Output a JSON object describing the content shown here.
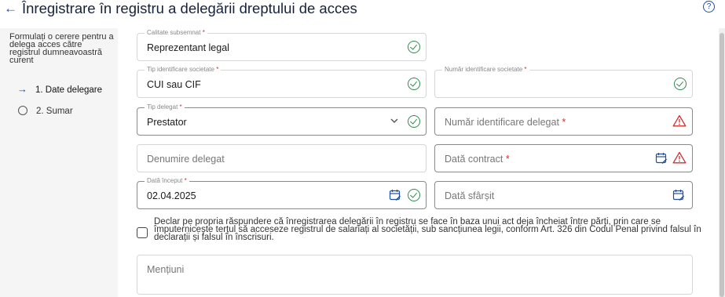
{
  "header": {
    "title": "Înregistrare în registru a delegării dreptului de acces",
    "back_icon": "arrow-left-icon",
    "help_glyph": "?"
  },
  "sidebar": {
    "description": "Formulați o cerere pentru a delega acces către registrul dumneavoastră curent",
    "steps": [
      {
        "label": "1. Date delegare",
        "state": "current"
      },
      {
        "label": "2. Sumar",
        "state": "pending"
      }
    ]
  },
  "form": {
    "calitate": {
      "label": "Calitate subsemnat",
      "required": "*",
      "value": "Reprezentant legal"
    },
    "tip_identificare": {
      "label": "Tip identificare societate",
      "required": "*",
      "value": "CUI sau CIF"
    },
    "numar_identificare_societate": {
      "label": "Număr identificare societate",
      "required": "*",
      "value": ""
    },
    "tip_delegat": {
      "label": "Tip delegat",
      "required": "*",
      "value": "Prestator"
    },
    "numar_identificare_delegat": {
      "placeholder": "Număr identificare delegat",
      "required": "*"
    },
    "denumire_delegat": {
      "placeholder": "Denumire delegat"
    },
    "data_contract": {
      "placeholder": "Dată contract",
      "required": "*"
    },
    "data_inceput": {
      "label": "Dată început",
      "required": "*",
      "value": "02.04.2025"
    },
    "data_sfarsit": {
      "placeholder": "Dată sfârșit"
    },
    "declaratie": "Declar pe propria răspundere că înregistrarea delegării în registru se face în baza unui act deja încheiat între părți, prin care se împuternicește terțul să acceseze registrul de salariați al societății, sub sancțiunea legii, conform Art. 326 din Codul Penal privind falsul în declarații și falsul în înscrisuri.",
    "mentiuni": {
      "placeholder": "Mențiuni"
    }
  },
  "colors": {
    "accent": "#1f4fa0",
    "success": "#2e8b4f",
    "error": "#d0302f"
  }
}
